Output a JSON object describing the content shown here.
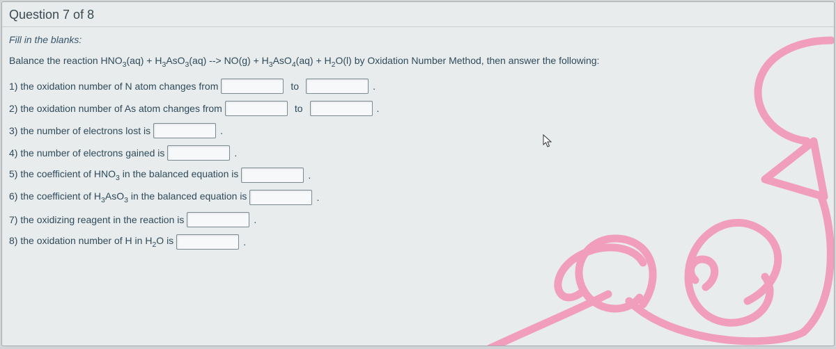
{
  "header": {
    "title": "Question 7 of 8"
  },
  "instruction": "Fill in the blanks:",
  "reaction": {
    "prefix": "Balance the reaction ",
    "eq_part1": "HNO",
    "eq_sub1": "3",
    "eq_part2": "(aq) + H",
    "eq_sub2": "3",
    "eq_part3": "AsO",
    "eq_sub3": "3",
    "eq_part4": "(aq)  -->  NO(g) + H",
    "eq_sub4": "3",
    "eq_part5": "AsO",
    "eq_sub5": "4",
    "eq_part6": "(aq) + H",
    "eq_sub6": "2",
    "eq_part7": "O(l) by Oxidation Number Method, then answer the following:"
  },
  "questions": {
    "q1": "1) the oxidation number of N atom changes from",
    "q2": "2) the oxidation number of As atom changes from",
    "q3": "3) the number of electrons lost is",
    "q4": "4) the number of electrons gained is",
    "q5_a": "5) the coefficient of HNO",
    "q5_sub": "3",
    "q5_b": " in the balanced equation is",
    "q6_a": "6) the coefficient of H",
    "q6_sub1": "3",
    "q6_b": "AsO",
    "q6_sub2": "3",
    "q6_c": " in the balanced equation is",
    "q7": "7) the oxidizing reagent in the reaction is",
    "q8_a": "8) the oxidation number of H in H",
    "q8_sub": "2",
    "q8_b": "O is"
  },
  "labels": {
    "to": "to",
    "period": "."
  }
}
